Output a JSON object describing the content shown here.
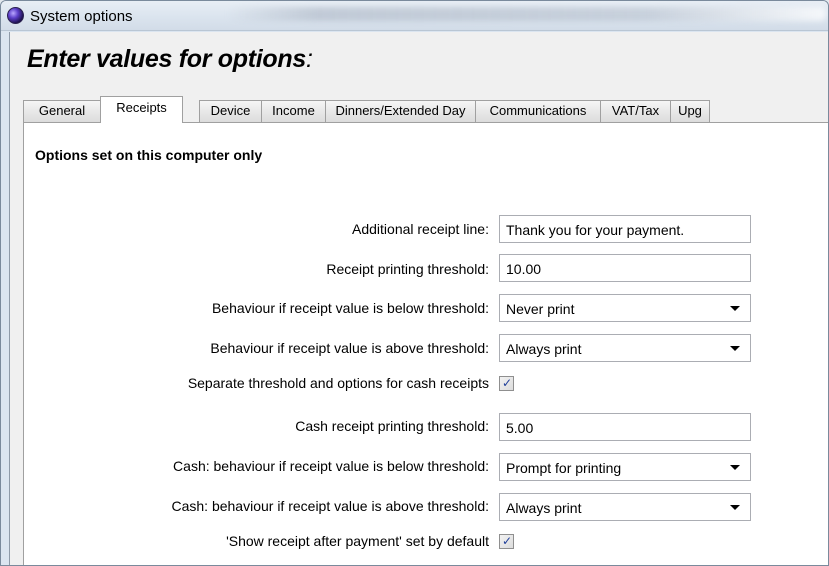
{
  "window": {
    "title": "System options"
  },
  "heading": {
    "text": "Enter values for options",
    "colon": ":"
  },
  "tabs": [
    {
      "label": "General"
    },
    {
      "label": "Receipts"
    },
    {
      "label": "Device"
    },
    {
      "label": "Income"
    },
    {
      "label": "Dinners/Extended Day"
    },
    {
      "label": "Communications"
    },
    {
      "label": "VAT/Tax"
    },
    {
      "label": "Upg"
    }
  ],
  "active_tab": "Receipts",
  "section": {
    "title": "Options set on this computer only"
  },
  "fields": {
    "additional_receipt_line": {
      "label": "Additional receipt line:",
      "value": "Thank you for your payment."
    },
    "receipt_threshold": {
      "label": "Receipt printing threshold:",
      "value": "10.00"
    },
    "below_threshold": {
      "label": "Behaviour if receipt value is below threshold:",
      "value": "Never print"
    },
    "above_threshold": {
      "label": "Behaviour if receipt value is above threshold:",
      "value": "Always print"
    },
    "separate_cash": {
      "label": "Separate threshold and options for cash receipts",
      "checked": true
    },
    "cash_threshold": {
      "label": "Cash receipt printing threshold:",
      "value": "5.00"
    },
    "cash_below": {
      "label": "Cash: behaviour if receipt value is below threshold:",
      "value": "Prompt for printing"
    },
    "cash_above": {
      "label": "Cash: behaviour if receipt value is above threshold:",
      "value": "Always print"
    },
    "show_receipt": {
      "label": "'Show receipt after payment' set by default",
      "checked": true
    }
  },
  "checkmark_glyph": "✓"
}
